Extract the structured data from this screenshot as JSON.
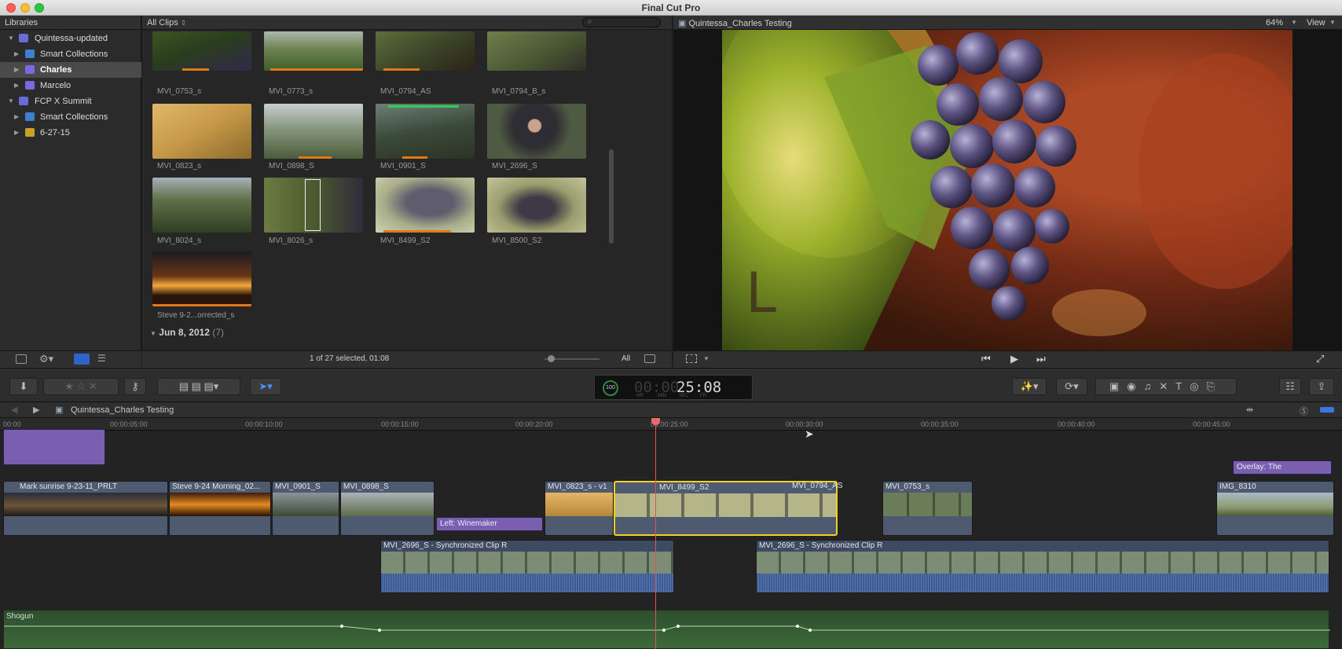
{
  "window": {
    "title": "Final Cut Pro"
  },
  "libraries": {
    "header": "Libraries",
    "items": [
      {
        "label": "Quintessa-updated",
        "icon": "library-icon"
      },
      {
        "label": "Smart Collections",
        "icon": "folder-icon"
      },
      {
        "label": "Charles",
        "icon": "event-icon"
      },
      {
        "label": "Marcelo",
        "icon": "event-icon"
      },
      {
        "label": "FCP X Summit",
        "icon": "library-icon"
      },
      {
        "label": "Smart Collections",
        "icon": "folder-icon"
      },
      {
        "label": "6-27-15",
        "icon": "event-icon"
      }
    ]
  },
  "browser": {
    "filter": "All Clips",
    "clips": [
      "MVI_0753_s",
      "MVI_0773_s",
      "MVI_0794_AS",
      "MVI_0794_B_s",
      "MVI_0823_s",
      "MVI_0898_S",
      "MVI_0901_S",
      "MVI_2696_S",
      "MVI_8024_s",
      "MVI_8026_s",
      "MVI_8499_S2",
      "MVI_8500_S2",
      "Steve 9-2...orrected_s"
    ],
    "group_label": "Jun 8, 2012",
    "group_count": "(7)",
    "status": "1 of 27 selected, 01:08",
    "zoom_label": "All"
  },
  "viewer": {
    "title": "Quintessa_Charles Testing",
    "zoom": "64%",
    "view_menu": "View",
    "overlay_letter": "L"
  },
  "toolbar": {
    "timecode": "25:08",
    "timecode_prefix": "00:00",
    "percent": "100",
    "tc_labels": [
      "HR",
      "MIN",
      "SEC",
      "FR"
    ]
  },
  "timeline": {
    "project": "Quintessa_Charles Testing",
    "ruler": [
      "00:00",
      "00:00:05:00",
      "00:00:10:00",
      "00:00:15:00",
      "00:00:20:00",
      "00:00:25:00",
      "00:00:30:00",
      "00:00:35:00",
      "00:00:40:00",
      "00:00:45:00"
    ],
    "primary_clips": [
      "Mark sunrise 9-23-11_PRLT",
      "Steve 9-24 Morning_02...",
      "MVI_0901_S",
      "MVI_0898_S",
      "MVI_0823_s - v1",
      "MVI_8499_S2",
      "MVI_0794_AS",
      "MVI_0753_s",
      "IMG_8310"
    ],
    "titles": [
      "Left: Winemaker",
      "Overlay: The"
    ],
    "connected": [
      "MVI_2696_S - Synchronized Clip R",
      "MVI_2696_S - Synchronized Clip R"
    ],
    "audio": "Shogun"
  }
}
